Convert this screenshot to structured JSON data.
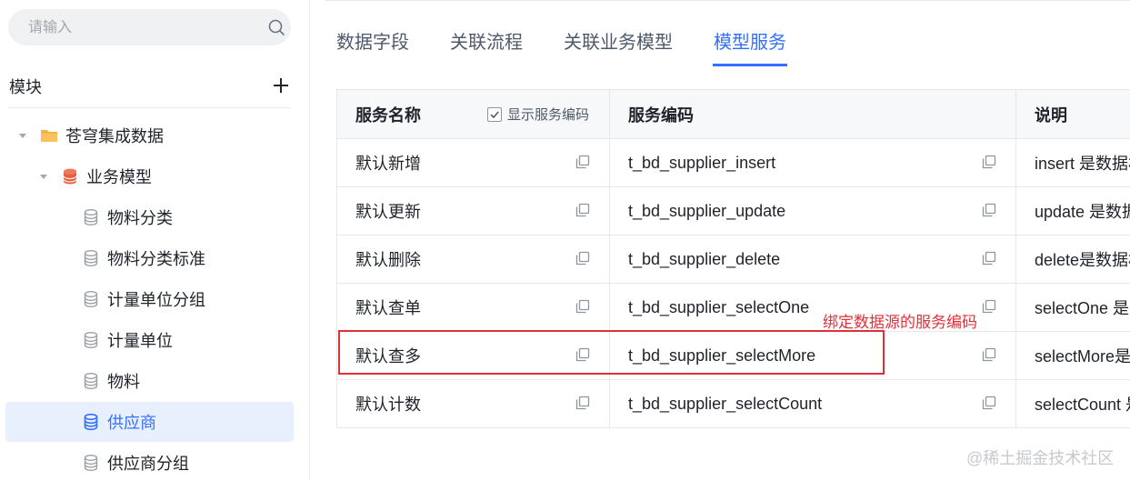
{
  "sidebar": {
    "search_placeholder": "请输入",
    "module_title": "模块",
    "tree": [
      {
        "label": "苍穹集成数据",
        "icon": "folder-icon"
      },
      {
        "label": "业务模型",
        "icon": "database-icon"
      },
      {
        "label": "物料分类",
        "icon": "database-icon"
      },
      {
        "label": "物料分类标准",
        "icon": "database-icon"
      },
      {
        "label": "计量单位分组",
        "icon": "database-icon"
      },
      {
        "label": "计量单位",
        "icon": "database-icon"
      },
      {
        "label": "物料",
        "icon": "database-icon"
      },
      {
        "label": "供应商",
        "icon": "database-icon",
        "selected": true
      },
      {
        "label": "供应商分组",
        "icon": "database-icon"
      }
    ]
  },
  "tabs": [
    {
      "label": "数据字段"
    },
    {
      "label": "关联流程"
    },
    {
      "label": "关联业务模型"
    },
    {
      "label": "模型服务",
      "active": true
    }
  ],
  "table": {
    "headers": {
      "name": "服务名称",
      "code": "服务编码",
      "desc": "说明"
    },
    "show_code_label": "显示服务编码",
    "show_code_checked": true,
    "rows": [
      {
        "name": "默认新增",
        "code": "t_bd_supplier_insert",
        "desc": "insert 是数据格"
      },
      {
        "name": "默认更新",
        "code": "t_bd_supplier_update",
        "desc": "update 是数据"
      },
      {
        "name": "默认删除",
        "code": "t_bd_supplier_delete",
        "desc": "delete是数据格"
      },
      {
        "name": "默认查单",
        "code": "t_bd_supplier_selectOne",
        "desc": "selectOne 是对"
      },
      {
        "name": "默认查多",
        "code": "t_bd_supplier_selectMore",
        "desc": "selectMore是对"
      },
      {
        "name": "默认计数",
        "code": "t_bd_supplier_selectCount",
        "desc": "selectCount 是"
      }
    ]
  },
  "annotation": {
    "text": "绑定数据源的服务编码",
    "color": "#e0303a"
  },
  "watermark": "@稀土掘金技术社区",
  "colors": {
    "accent": "#3370ff",
    "selected_bg": "#e8f0fd",
    "annotation": "#e0303a"
  }
}
